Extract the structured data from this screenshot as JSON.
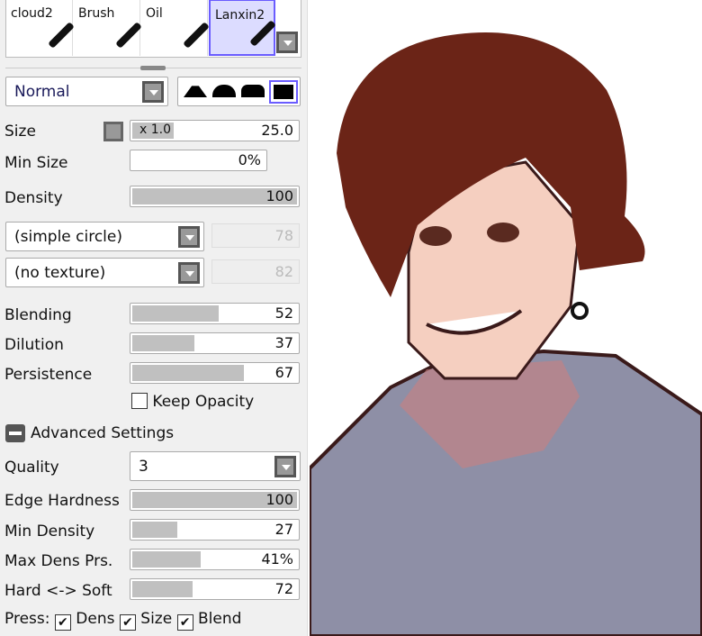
{
  "brushes": [
    {
      "name": "cloud2"
    },
    {
      "name": "Brush"
    },
    {
      "name": "Oil"
    },
    {
      "name": "Lanxin2",
      "selected": true
    }
  ],
  "blend_mode": "Normal",
  "size": {
    "label": "Size",
    "multiplier": "x 1.0",
    "value": "25.0"
  },
  "min_size": {
    "label": "Min Size",
    "value": "0%"
  },
  "density": {
    "label": "Density",
    "value": "100",
    "fraction": 1.0
  },
  "shape": {
    "value": "(simple circle)",
    "strength": "78"
  },
  "texture": {
    "value": "(no texture)",
    "strength": "82"
  },
  "blending": {
    "label": "Blending",
    "value": "52",
    "fraction": 0.52
  },
  "dilution": {
    "label": "Dilution",
    "value": "37",
    "fraction": 0.37
  },
  "persistence": {
    "label": "Persistence",
    "value": "67",
    "fraction": 0.67
  },
  "keep_opacity": {
    "label": "Keep Opacity",
    "checked": false
  },
  "advanced": {
    "label": "Advanced Settings"
  },
  "quality": {
    "label": "Quality",
    "value": "3"
  },
  "edge_hardness": {
    "label": "Edge Hardness",
    "value": "100",
    "fraction": 1.0
  },
  "min_density": {
    "label": "Min Density",
    "value": "27",
    "fraction": 0.27
  },
  "max_dens_prs": {
    "label": "Max Dens Prs.",
    "value": "41%",
    "fraction": 0.41
  },
  "hard_soft": {
    "label": "Hard <-> Soft",
    "value": "72",
    "fraction": 0.39
  },
  "press": {
    "label": "Press:",
    "dens": "Dens",
    "size": "Size",
    "blend": "Blend"
  },
  "colors": {
    "accent": "#6a5cff",
    "hair": "#6b2417",
    "skin": "#f5cfc0",
    "hoodie": "#8e8fa6"
  }
}
